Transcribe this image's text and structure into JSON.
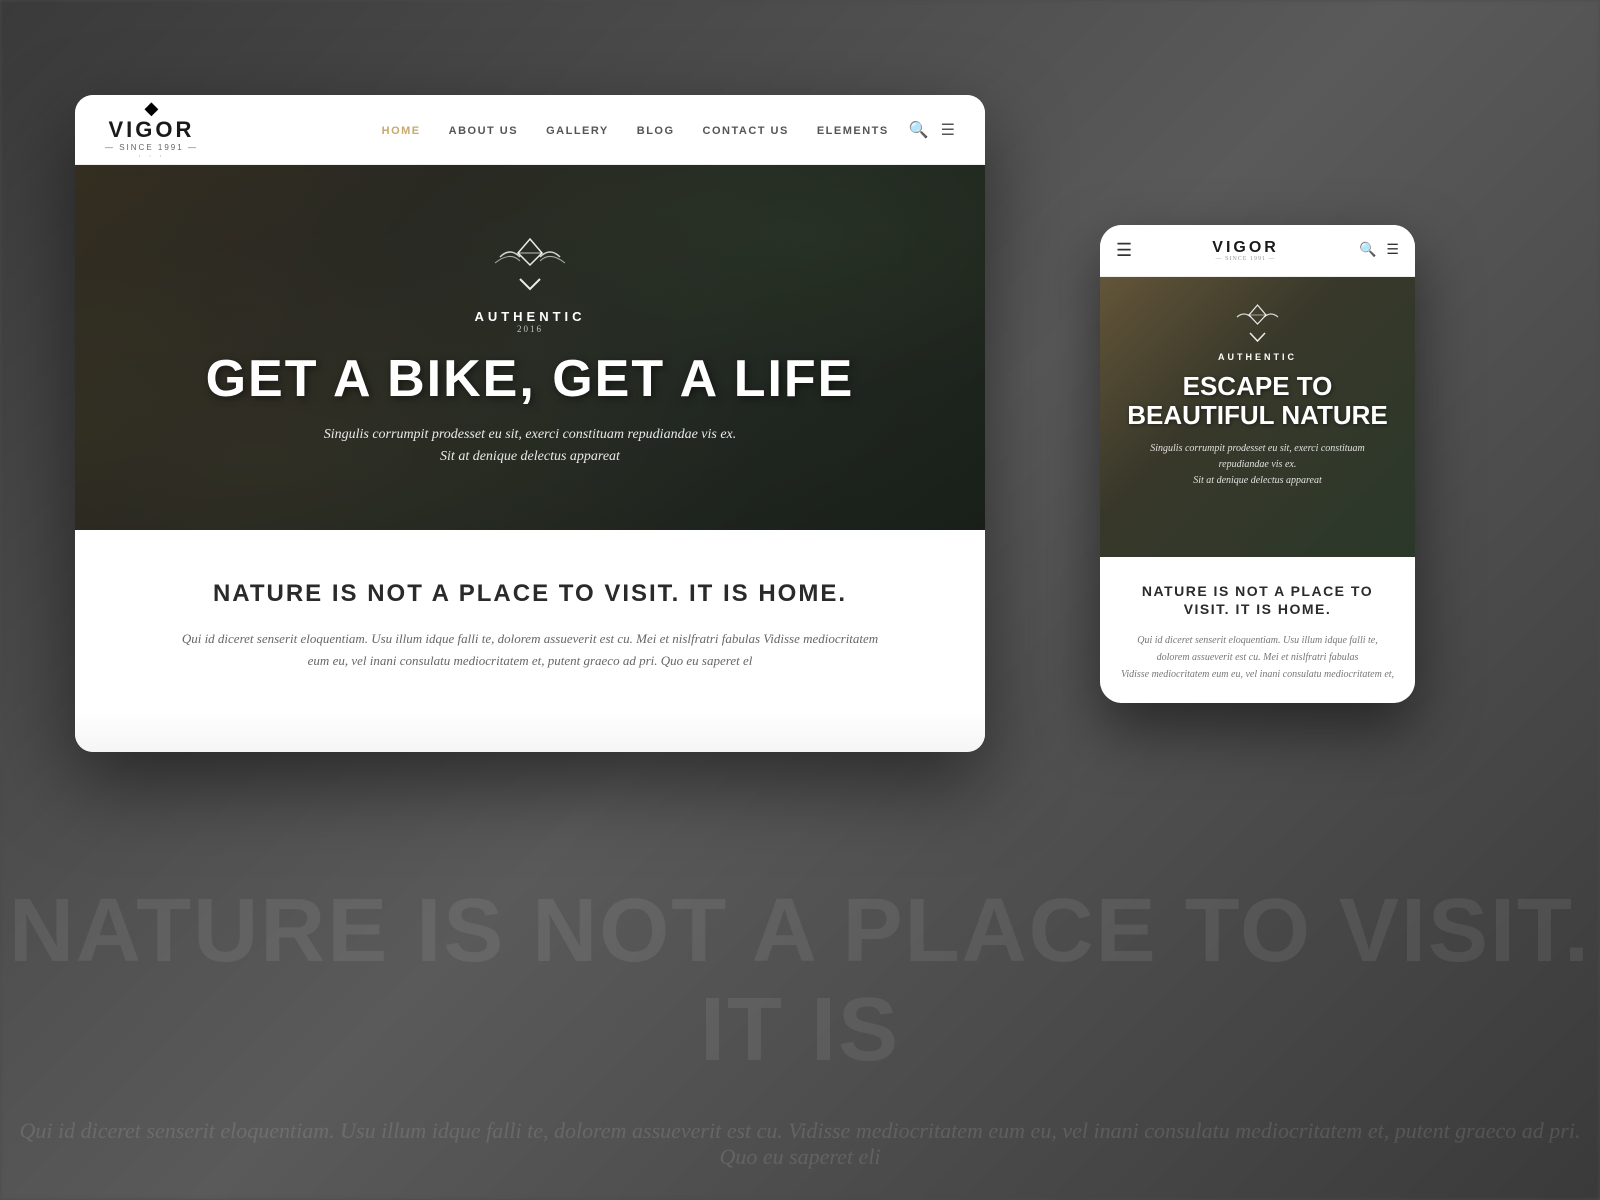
{
  "background": {
    "watermark_line1": "NATURE IS NOT A PLACE TO VISIT. IT IS",
    "watermark_line2": "Qui id diceret senserit eloquentiam. Usu illum idque falli te, dolorem assueverit est cu."
  },
  "desktop": {
    "logo": {
      "icon": "◆",
      "name": "VIGOR",
      "since": "— SINCE 1991 —",
      "dots": "· · ·"
    },
    "nav": {
      "links": [
        {
          "label": "HOME",
          "active": true
        },
        {
          "label": "ABOUT US",
          "active": false
        },
        {
          "label": "GALLERY",
          "active": false
        },
        {
          "label": "BLOG",
          "active": false
        },
        {
          "label": "CONTACT US",
          "active": false
        },
        {
          "label": "ELEMENTS",
          "active": false
        }
      ]
    },
    "hero": {
      "badge_text": "AUTHENTIC",
      "badge_year": "2016",
      "title": "GET A BIKE, GET A LIFE",
      "subtitle_line1": "Singulis corrumpit prodesset eu sit, exerci constituam repudiandae vis ex.",
      "subtitle_line2": "Sit at denique delectus appareat"
    },
    "content": {
      "title": "NATURE IS NOT A PLACE TO VISIT. IT IS HOME.",
      "text": "Qui id diceret senserit eloquentiam. Usu illum idque falli te, dolorem assueverit est cu. Mei et nislfratri fabulas Vidisse mediocritatem eum eu, vel inani consulatu mediocritatem et, putent graeco ad pri. Quo eu saperet el"
    }
  },
  "mobile": {
    "logo": {
      "icon": "◆",
      "name": "VIGOR",
      "since": "— SINCE 1991 —"
    },
    "hero": {
      "badge_text": "AUTHENTIC",
      "title": "ESCAPE TO BEAUTIFUL NATURE",
      "subtitle_line1": "Singulis corrumpit prodesset eu sit, exerci constituam",
      "subtitle_line2": "repudiandae vis ex.",
      "subtitle_line3": "Sit at denique delectus appareat"
    },
    "content": {
      "title": "NATURE IS NOT A PLACE TO VISIT. IT IS HOME.",
      "text_line1": "Qui id diceret senserit eloquentiam. Usu illum idque falli te, dolorem assueverit est cu. Mei et nislfratri fabulas",
      "text_line2": "Vidisse mediocritatem eum eu, vel inani consulatu mediocritatem et,"
    }
  }
}
